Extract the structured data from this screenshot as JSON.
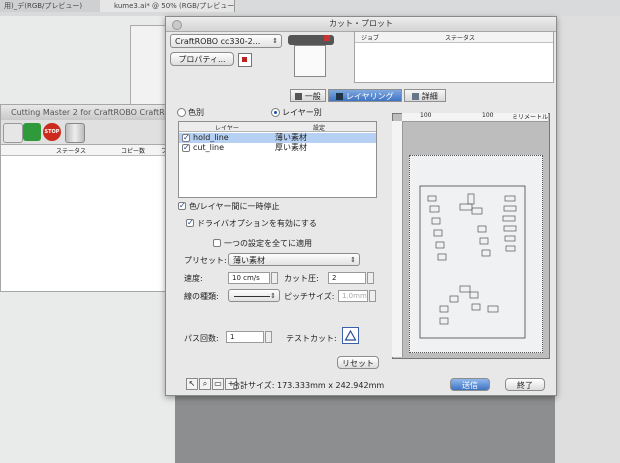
{
  "background": {
    "tab1_title": "用)_デ(RGB/プレビュー)",
    "tab2_title": "kume3.ai* @ 50% (RGB/プレビュー)"
  },
  "cutting_master": {
    "title": "Cutting Master 2 for CraftROBO CraftRO",
    "stop_label": "STOP",
    "col_status": "ステータス",
    "col_copies": "コピー数",
    "col_extra": "ファ"
  },
  "dialog": {
    "title": "カット・プロット",
    "device": "CraftROBO cc330-2...",
    "properties_button": "プロパティ...",
    "job_table": {
      "col_job": "ジョブ",
      "col_status": "ステータス"
    },
    "tabs": [
      {
        "label": "一般",
        "selected": false
      },
      {
        "label": "レイヤリング",
        "selected": true
      },
      {
        "label": "詳細",
        "selected": false
      }
    ],
    "mode": {
      "color_label": "色別",
      "layer_label": "レイヤー別",
      "selected": "layer"
    },
    "layers": {
      "col_layer": "レイヤー",
      "col_setting": "設定",
      "rows": [
        {
          "name": "hold_line",
          "setting": "薄い素材",
          "checked": true,
          "selected": true
        },
        {
          "name": "cut_line",
          "setting": "厚い素材",
          "checked": true,
          "selected": false
        }
      ]
    },
    "pause_between": {
      "label": "色/レイヤー間に一時停止",
      "checked": true
    },
    "driver_options": {
      "label": "ドライバオプションを有効にする",
      "checked": true
    },
    "apply_all": {
      "label": "一つの設定を全てに適用",
      "checked": false
    },
    "preset": {
      "label": "プリセット:",
      "value": "薄い素材"
    },
    "speed": {
      "label": "速度:",
      "value": "10 cm/s"
    },
    "pressure": {
      "label": "カット圧:",
      "value": "2"
    },
    "line_type": {
      "label": "線の種類:"
    },
    "pitch": {
      "label": "ピッチサイズ:",
      "value": "1.0mm"
    },
    "passes": {
      "label": "パス回数:",
      "value": "1"
    },
    "test_cut": {
      "label": "テストカット:"
    },
    "reset_button": "リセット",
    "total_size": "合計サイズ:  173.333mm x 242.942mm",
    "send_button": "送信",
    "quit_button": "終了",
    "ruler": {
      "tick_100": "100",
      "unit": "ミリメートル",
      "tick_0": "0",
      "tick_100b": "100"
    }
  },
  "colors": {
    "accent": "#3f74c4",
    "selection": "#b5d0f2",
    "stop_red": "#cc2a1c"
  }
}
